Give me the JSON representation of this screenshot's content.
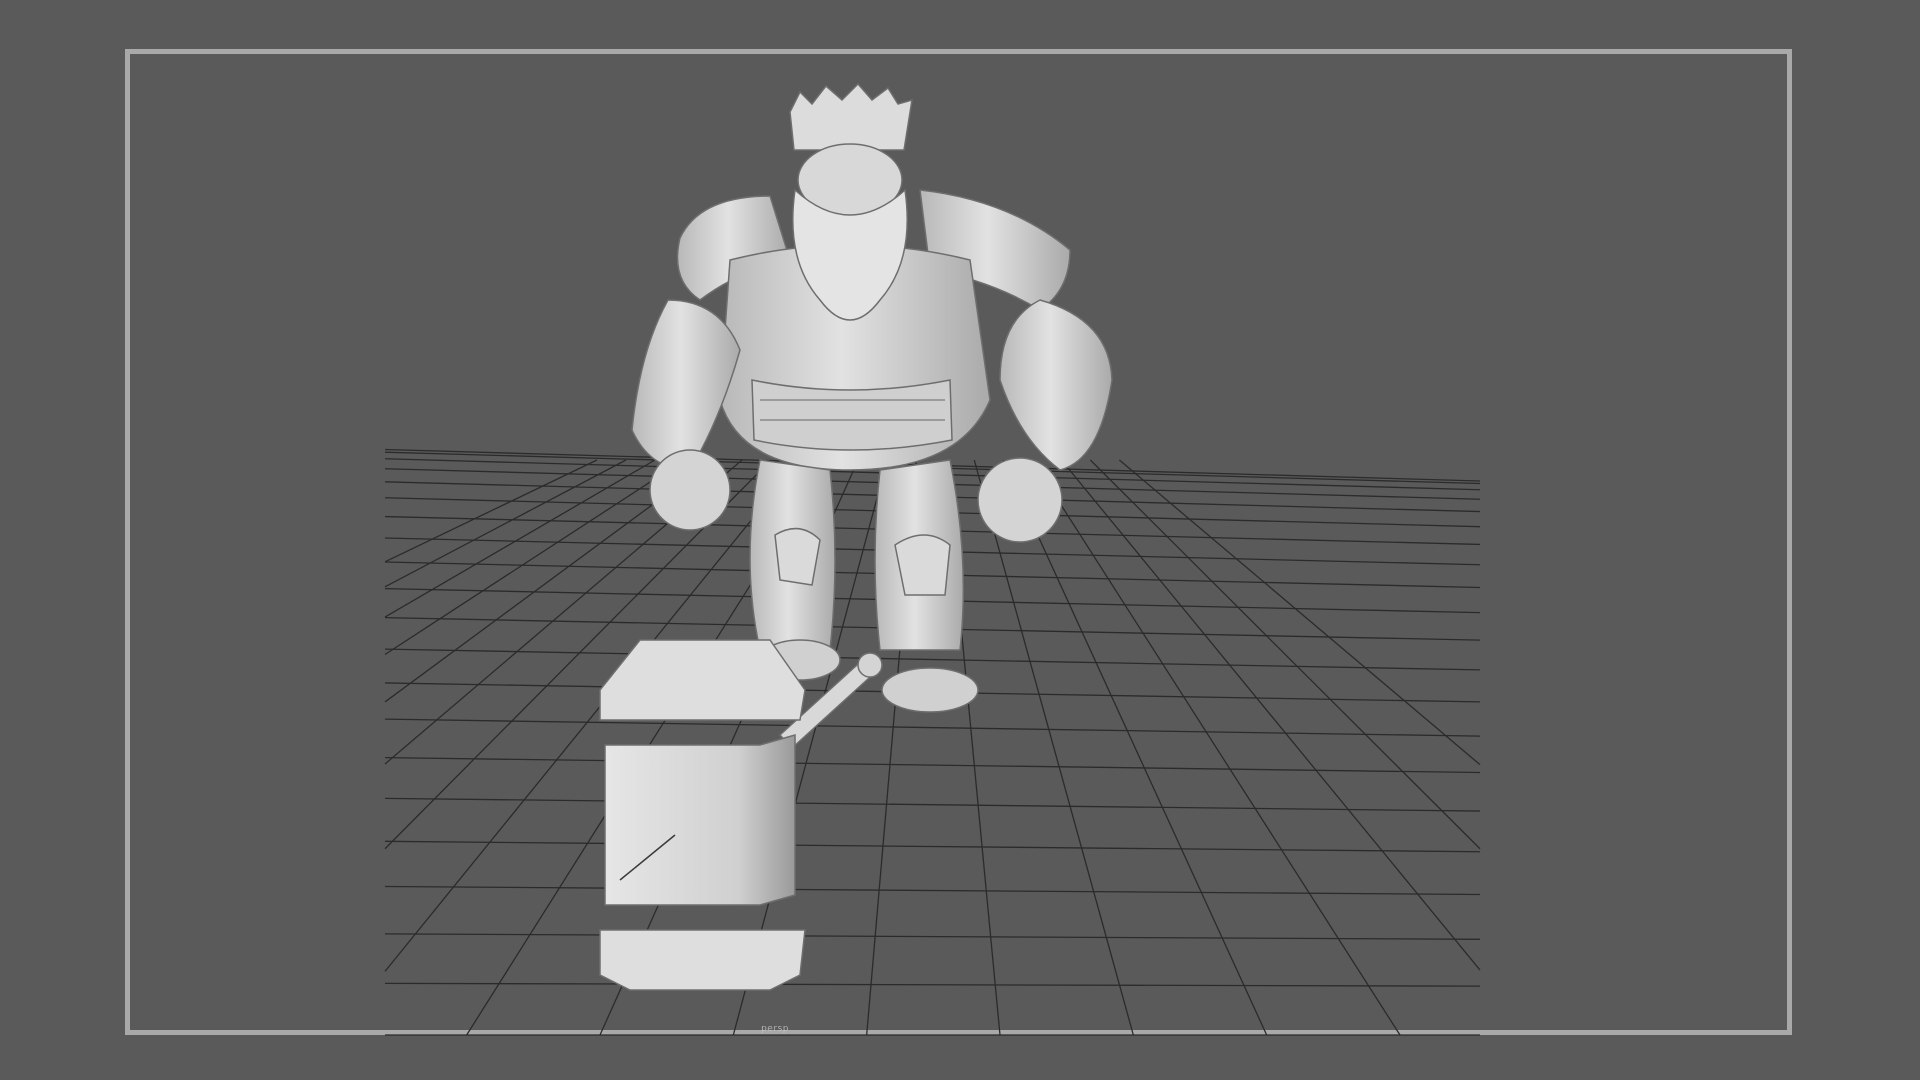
{
  "viewport": {
    "background_color": "#5a5a5a",
    "gate_color": "#a9a9a9",
    "grid_color": "#2b2b2b",
    "model_color": "#d6d6d6",
    "camera_label": "persp"
  },
  "scene": {
    "subject": "dwarf-king-sculpt",
    "prop": "war-hammer"
  }
}
